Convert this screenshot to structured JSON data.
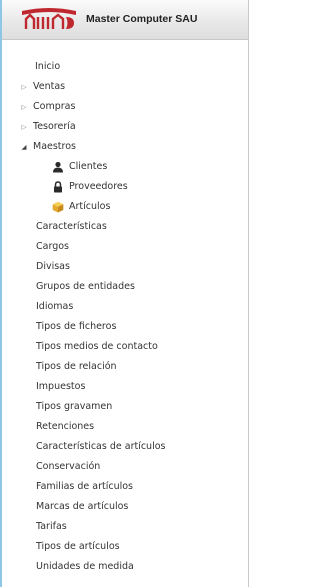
{
  "header": {
    "company_name": "Master Computer SAU",
    "logo_icon": "master-computer-logo-icon",
    "accent_color": "#c0282f"
  },
  "nav": {
    "inicio": "Inicio",
    "ventas": "Ventas",
    "compras": "Compras",
    "tesoreria": "Tesorería",
    "maestros": "Maestros"
  },
  "maestros_items": {
    "clientes": "Clientes",
    "proveedores": "Proveedores",
    "articulos": "Artículos",
    "caracteristicas": "Características",
    "cargos": "Cargos",
    "divisas": "Divisas",
    "grupos_entidades": "Grupos de entidades",
    "idiomas": "Idiomas",
    "tipos_ficheros": "Tipos de ficheros",
    "tipos_medios_contacto": "Tipos medios de contacto",
    "tipos_relacion": "Tipos de relación",
    "impuestos": "Impuestos",
    "tipos_gravamen": "Tipos gravamen",
    "retenciones": "Retenciones",
    "caracteristicas_articulos": "Características de artículos",
    "conservacion": "Conservación",
    "familias_articulos": "Familias de artículos",
    "marcas_articulos": "Marcas de artículos",
    "tarifas": "Tarifas",
    "tipos_articulos": "Tipos de artículos",
    "unidades_medida": "Unidades de medida"
  },
  "icons": {
    "collapsed": "triangle-right-outline-icon",
    "expanded": "triangle-down-filled-icon",
    "clientes": "user-icon",
    "proveedores": "lock-icon",
    "articulos": "box-icon"
  }
}
